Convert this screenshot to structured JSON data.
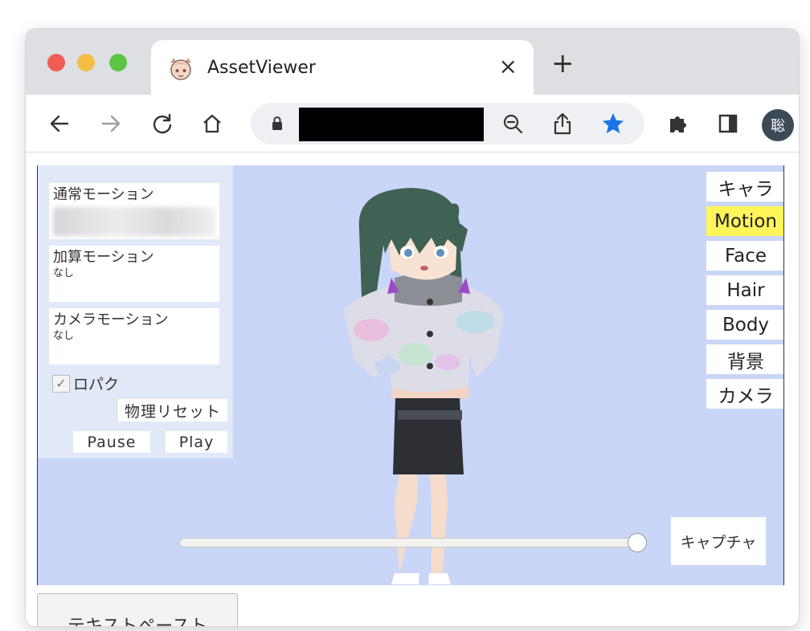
{
  "browser": {
    "tab_title": "AssetViewer",
    "tab_close": "×",
    "new_tab": "+",
    "profile_initial": "聡"
  },
  "panel": {
    "normal_motion_label": "通常モーション",
    "additive_motion_label": "加算モーション",
    "additive_motion_value": "なし",
    "camera_motion_label": "カメラモーション",
    "camera_motion_value": "なし",
    "lip_sync_label": "ロパク",
    "lip_sync_checked": true,
    "physics_reset_label": "物理リセット",
    "pause_label": "Pause",
    "play_label": "Play"
  },
  "menu": {
    "items": [
      "キャラ",
      "Motion",
      "Face",
      "Hair",
      "Body",
      "背景",
      "カメラ"
    ],
    "active": "Motion",
    "active_color": "#fff45a"
  },
  "timeline": {
    "position": 0.98
  },
  "capture_label": "キャプチャ",
  "paste_label": "テキストペースト",
  "colors": {
    "viewer_bg": "#c9d6f7",
    "panel_bg": "#e1e8f8",
    "bookmark_star": "#1a73e8"
  }
}
